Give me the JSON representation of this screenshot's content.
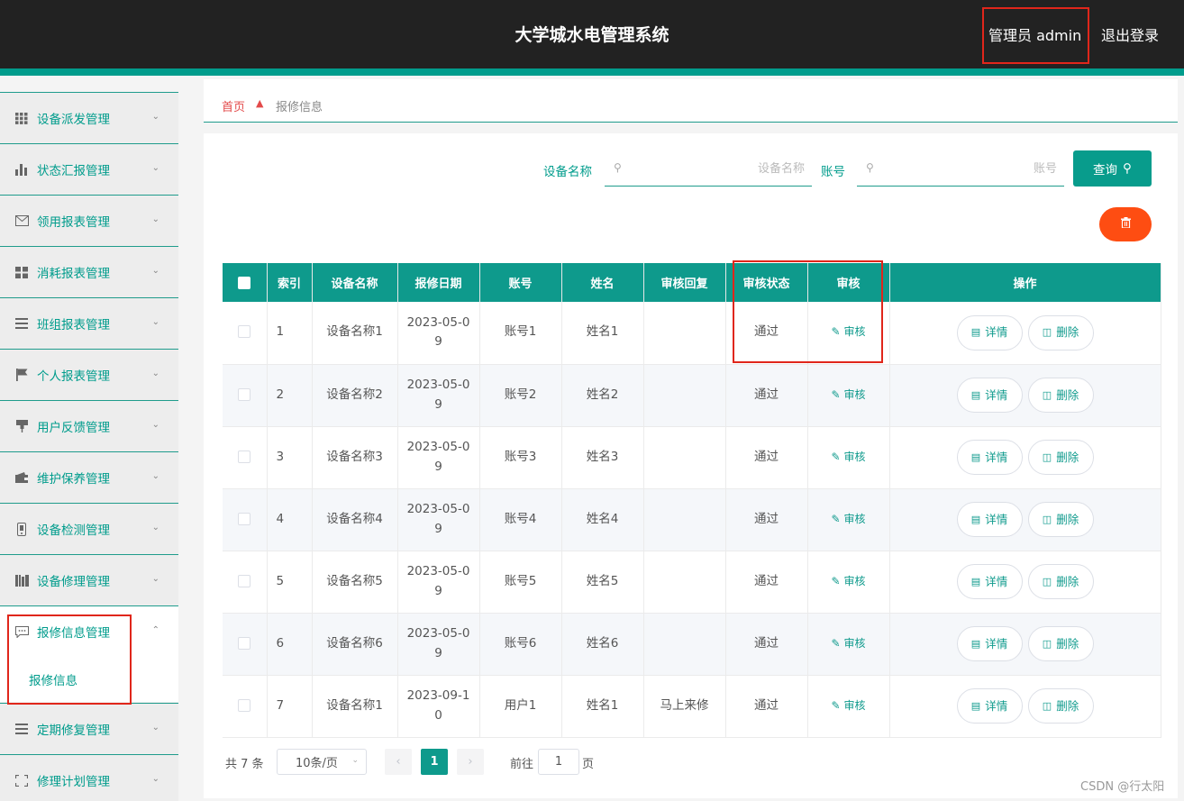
{
  "header": {
    "title": "大学城水电管理系统",
    "admin_label": "管理员 admin",
    "logout": "退出登录"
  },
  "sidebar": {
    "items": [
      {
        "label": "设备派发管理",
        "icon": "grid-icon"
      },
      {
        "label": "状态汇报管理",
        "icon": "bar-chart-icon"
      },
      {
        "label": "领用报表管理",
        "icon": "mail-icon"
      },
      {
        "label": "消耗报表管理",
        "icon": "tiles-icon"
      },
      {
        "label": "班组报表管理",
        "icon": "list-icon"
      },
      {
        "label": "个人报表管理",
        "icon": "flag-icon"
      },
      {
        "label": "用户反馈管理",
        "icon": "pin-icon"
      },
      {
        "label": "维护保养管理",
        "icon": "wallet-icon"
      },
      {
        "label": "设备检测管理",
        "icon": "phone-icon"
      },
      {
        "label": "设备修理管理",
        "icon": "book-icon"
      },
      {
        "label": "报修信息管理",
        "icon": "chat-icon"
      },
      {
        "label": "定期修复管理",
        "icon": "lines-icon"
      },
      {
        "label": "修理计划管理",
        "icon": "frame-icon"
      }
    ],
    "active_sub": "报修信息"
  },
  "breadcrumb": {
    "home": "首页",
    "current": "报修信息"
  },
  "search": {
    "name_label": "设备名称",
    "name_placeholder": "设备名称",
    "account_label": "账号",
    "account_placeholder": "账号",
    "query_button": "查询"
  },
  "table": {
    "columns": [
      "索引",
      "设备名称",
      "报修日期",
      "账号",
      "姓名",
      "审核回复",
      "审核状态",
      "审核",
      "操作"
    ],
    "audit_link": "审核",
    "detail_button": "详情",
    "delete_button": "删除",
    "rows": [
      {
        "index": "1",
        "device": "设备名称1",
        "date1": "2023-05-0",
        "date2": "9",
        "account": "账号1",
        "name": "姓名1",
        "reply": "",
        "status": "通过"
      },
      {
        "index": "2",
        "device": "设备名称2",
        "date1": "2023-05-0",
        "date2": "9",
        "account": "账号2",
        "name": "姓名2",
        "reply": "",
        "status": "通过"
      },
      {
        "index": "3",
        "device": "设备名称3",
        "date1": "2023-05-0",
        "date2": "9",
        "account": "账号3",
        "name": "姓名3",
        "reply": "",
        "status": "通过"
      },
      {
        "index": "4",
        "device": "设备名称4",
        "date1": "2023-05-0",
        "date2": "9",
        "account": "账号4",
        "name": "姓名4",
        "reply": "",
        "status": "通过"
      },
      {
        "index": "5",
        "device": "设备名称5",
        "date1": "2023-05-0",
        "date2": "9",
        "account": "账号5",
        "name": "姓名5",
        "reply": "",
        "status": "通过"
      },
      {
        "index": "6",
        "device": "设备名称6",
        "date1": "2023-05-0",
        "date2": "9",
        "account": "账号6",
        "name": "姓名6",
        "reply": "",
        "status": "通过"
      },
      {
        "index": "7",
        "device": "设备名称1",
        "date1": "2023-09-1",
        "date2": "0",
        "account": "用户1",
        "name": "姓名1",
        "reply": "马上来修",
        "status": "通过"
      }
    ]
  },
  "pagination": {
    "total": "共 7 条",
    "page_size": "10条/页",
    "current_page": "1",
    "goto_label": "前往",
    "goto_value": "1",
    "page_unit": "页"
  },
  "watermark": "CSDN @行太阳",
  "colors": {
    "accent": "#0e9a8c",
    "header_bg": "#222222",
    "danger": "#fe4d12",
    "highlight_box": "#e0261b"
  }
}
